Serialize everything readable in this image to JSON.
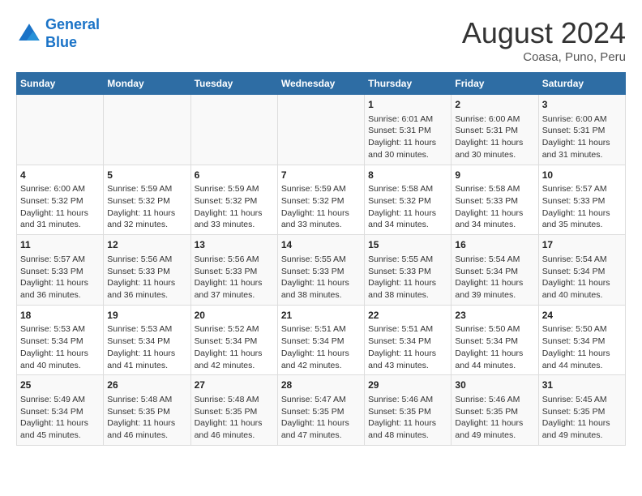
{
  "header": {
    "logo_line1": "General",
    "logo_line2": "Blue",
    "month_title": "August 2024",
    "location": "Coasa, Puno, Peru"
  },
  "days_of_week": [
    "Sunday",
    "Monday",
    "Tuesday",
    "Wednesday",
    "Thursday",
    "Friday",
    "Saturday"
  ],
  "weeks": [
    [
      {
        "day": "",
        "info": ""
      },
      {
        "day": "",
        "info": ""
      },
      {
        "day": "",
        "info": ""
      },
      {
        "day": "",
        "info": ""
      },
      {
        "day": "1",
        "info": "Sunrise: 6:01 AM\nSunset: 5:31 PM\nDaylight: 11 hours and 30 minutes."
      },
      {
        "day": "2",
        "info": "Sunrise: 6:00 AM\nSunset: 5:31 PM\nDaylight: 11 hours and 30 minutes."
      },
      {
        "day": "3",
        "info": "Sunrise: 6:00 AM\nSunset: 5:31 PM\nDaylight: 11 hours and 31 minutes."
      }
    ],
    [
      {
        "day": "4",
        "info": "Sunrise: 6:00 AM\nSunset: 5:32 PM\nDaylight: 11 hours and 31 minutes."
      },
      {
        "day": "5",
        "info": "Sunrise: 5:59 AM\nSunset: 5:32 PM\nDaylight: 11 hours and 32 minutes."
      },
      {
        "day": "6",
        "info": "Sunrise: 5:59 AM\nSunset: 5:32 PM\nDaylight: 11 hours and 33 minutes."
      },
      {
        "day": "7",
        "info": "Sunrise: 5:59 AM\nSunset: 5:32 PM\nDaylight: 11 hours and 33 minutes."
      },
      {
        "day": "8",
        "info": "Sunrise: 5:58 AM\nSunset: 5:32 PM\nDaylight: 11 hours and 34 minutes."
      },
      {
        "day": "9",
        "info": "Sunrise: 5:58 AM\nSunset: 5:33 PM\nDaylight: 11 hours and 34 minutes."
      },
      {
        "day": "10",
        "info": "Sunrise: 5:57 AM\nSunset: 5:33 PM\nDaylight: 11 hours and 35 minutes."
      }
    ],
    [
      {
        "day": "11",
        "info": "Sunrise: 5:57 AM\nSunset: 5:33 PM\nDaylight: 11 hours and 36 minutes."
      },
      {
        "day": "12",
        "info": "Sunrise: 5:56 AM\nSunset: 5:33 PM\nDaylight: 11 hours and 36 minutes."
      },
      {
        "day": "13",
        "info": "Sunrise: 5:56 AM\nSunset: 5:33 PM\nDaylight: 11 hours and 37 minutes."
      },
      {
        "day": "14",
        "info": "Sunrise: 5:55 AM\nSunset: 5:33 PM\nDaylight: 11 hours and 38 minutes."
      },
      {
        "day": "15",
        "info": "Sunrise: 5:55 AM\nSunset: 5:33 PM\nDaylight: 11 hours and 38 minutes."
      },
      {
        "day": "16",
        "info": "Sunrise: 5:54 AM\nSunset: 5:34 PM\nDaylight: 11 hours and 39 minutes."
      },
      {
        "day": "17",
        "info": "Sunrise: 5:54 AM\nSunset: 5:34 PM\nDaylight: 11 hours and 40 minutes."
      }
    ],
    [
      {
        "day": "18",
        "info": "Sunrise: 5:53 AM\nSunset: 5:34 PM\nDaylight: 11 hours and 40 minutes."
      },
      {
        "day": "19",
        "info": "Sunrise: 5:53 AM\nSunset: 5:34 PM\nDaylight: 11 hours and 41 minutes."
      },
      {
        "day": "20",
        "info": "Sunrise: 5:52 AM\nSunset: 5:34 PM\nDaylight: 11 hours and 42 minutes."
      },
      {
        "day": "21",
        "info": "Sunrise: 5:51 AM\nSunset: 5:34 PM\nDaylight: 11 hours and 42 minutes."
      },
      {
        "day": "22",
        "info": "Sunrise: 5:51 AM\nSunset: 5:34 PM\nDaylight: 11 hours and 43 minutes."
      },
      {
        "day": "23",
        "info": "Sunrise: 5:50 AM\nSunset: 5:34 PM\nDaylight: 11 hours and 44 minutes."
      },
      {
        "day": "24",
        "info": "Sunrise: 5:50 AM\nSunset: 5:34 PM\nDaylight: 11 hours and 44 minutes."
      }
    ],
    [
      {
        "day": "25",
        "info": "Sunrise: 5:49 AM\nSunset: 5:34 PM\nDaylight: 11 hours and 45 minutes."
      },
      {
        "day": "26",
        "info": "Sunrise: 5:48 AM\nSunset: 5:35 PM\nDaylight: 11 hours and 46 minutes."
      },
      {
        "day": "27",
        "info": "Sunrise: 5:48 AM\nSunset: 5:35 PM\nDaylight: 11 hours and 46 minutes."
      },
      {
        "day": "28",
        "info": "Sunrise: 5:47 AM\nSunset: 5:35 PM\nDaylight: 11 hours and 47 minutes."
      },
      {
        "day": "29",
        "info": "Sunrise: 5:46 AM\nSunset: 5:35 PM\nDaylight: 11 hours and 48 minutes."
      },
      {
        "day": "30",
        "info": "Sunrise: 5:46 AM\nSunset: 5:35 PM\nDaylight: 11 hours and 49 minutes."
      },
      {
        "day": "31",
        "info": "Sunrise: 5:45 AM\nSunset: 5:35 PM\nDaylight: 11 hours and 49 minutes."
      }
    ]
  ]
}
